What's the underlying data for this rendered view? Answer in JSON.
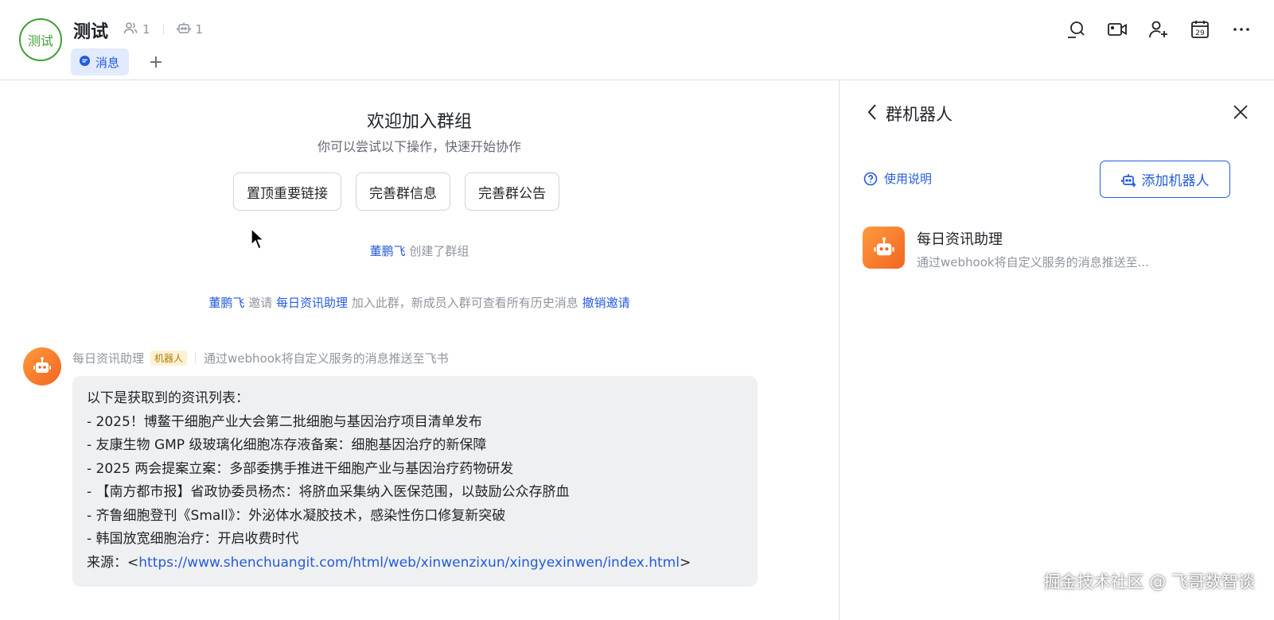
{
  "header": {
    "avatar_text": "测试",
    "group_name": "测试",
    "members_count": "1",
    "bots_count": "1",
    "tabs": [
      {
        "label": "消息"
      }
    ],
    "add_tab_label": "+"
  },
  "welcome": {
    "title": "欢迎加入群组",
    "subtitle": "你可以尝试以下操作，快速开始协作",
    "actions": [
      "置顶重要链接",
      "完善群信息",
      "完善群公告"
    ]
  },
  "system": {
    "created": {
      "user": "董鹏飞",
      "text": "创建了群组"
    },
    "invite": {
      "user": "董鹏飞",
      "verb": "邀请",
      "target": "每日资讯助理",
      "text": "加入此群，新成员入群可查看所有历史消息",
      "revoke": "撤销邀请"
    }
  },
  "message": {
    "sender": "每日资讯助理",
    "tag": "机器人",
    "sender_desc": "通过webhook将自定义服务的消息推送至飞书",
    "lines": [
      "以下是获取到的资讯列表：",
      "- 2025！博鳌干细胞产业大会第二批细胞与基因治疗项目清单发布",
      "- 友康生物 GMP 级玻璃化细胞冻存液备案：细胞基因治疗的新保障",
      "- 2025 两会提案立案：多部委携手推进干细胞产业与基因治疗药物研发",
      "- 【南方都市报】省政协委员杨杰：将脐血采集纳入医保范围，以鼓励公众存脐血",
      "- 齐鲁细胞登刊《Small》：外泌体水凝胶技术，感染性伤口修复新突破",
      "- 韩国放宽细胞治疗：开启收费时代"
    ],
    "source_label": "来源：<",
    "source_url": "https://www.shenchuangit.com/html/web/xinwenzixun/xingyexinwen/index.html",
    "source_end": ">"
  },
  "panel": {
    "title": "群机器人",
    "help": "使用说明",
    "add_button": "添加机器人",
    "bots": [
      {
        "name": "每日资讯助理",
        "desc": "通过webhook将自定义服务的消息推送至..."
      }
    ]
  },
  "watermark": "掘金技术社区 @ 飞哥数智谈",
  "colors": {
    "accent": "#245bdb",
    "brand_green": "#3fa033",
    "bot_orange": "#f26522"
  }
}
